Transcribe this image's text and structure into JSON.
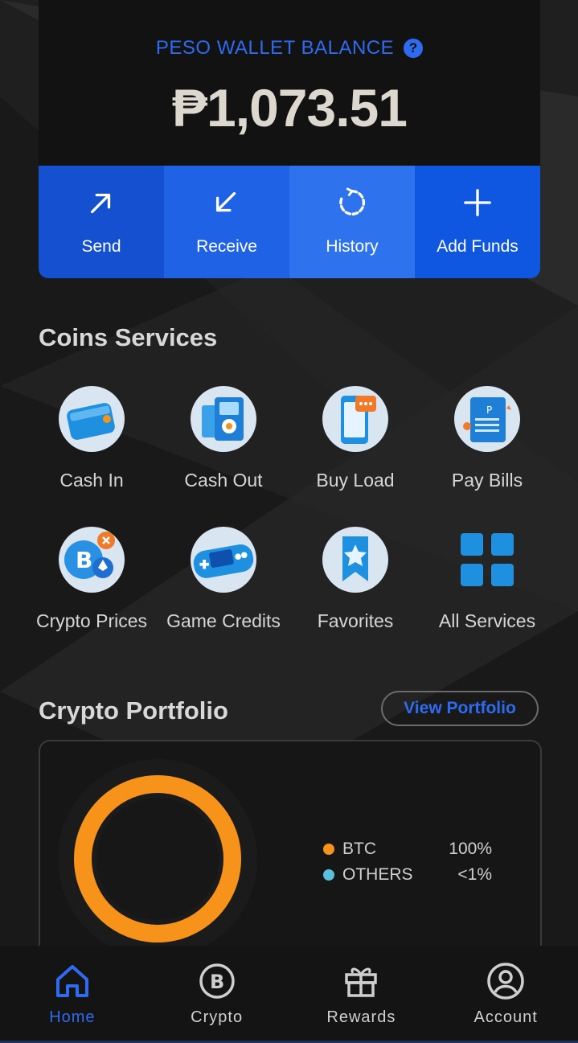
{
  "balance": {
    "title": "PESO WALLET BALANCE",
    "amount": "₱1,073.51"
  },
  "actions": [
    {
      "label": "Send",
      "icon": "arrow-up-right-icon"
    },
    {
      "label": "Receive",
      "icon": "arrow-down-left-icon"
    },
    {
      "label": "History",
      "icon": "history-icon"
    },
    {
      "label": "Add Funds",
      "icon": "plus-icon"
    }
  ],
  "services": {
    "title": "Coins Services",
    "items": [
      {
        "label": "Cash In",
        "icon": "wallet-icon"
      },
      {
        "label": "Cash Out",
        "icon": "cash-out-icon"
      },
      {
        "label": "Buy Load",
        "icon": "phone-icon"
      },
      {
        "label": "Pay Bills",
        "icon": "bill-icon"
      },
      {
        "label": "Crypto Prices",
        "icon": "crypto-coins-icon"
      },
      {
        "label": "Game Credits",
        "icon": "gamepad-icon"
      },
      {
        "label": "Favorites",
        "icon": "star-bookmark-icon"
      },
      {
        "label": "All Services",
        "icon": "grid-icon"
      }
    ]
  },
  "portfolio": {
    "title": "Crypto Portfolio",
    "view_label": "View Portfolio",
    "legend": [
      {
        "name": "BTC",
        "value": "100%",
        "color": "#f7931a"
      },
      {
        "name": "OTHERS",
        "value": "<1%",
        "color": "#5bc0de"
      }
    ]
  },
  "chart_data": {
    "type": "pie",
    "categories": [
      "BTC",
      "OTHERS"
    ],
    "values": [
      100,
      0
    ],
    "colors": [
      "#f7931a",
      "#5bc0de"
    ]
  },
  "nav": {
    "items": [
      {
        "label": "Home",
        "icon": "home-icon",
        "active": true
      },
      {
        "label": "Crypto",
        "icon": "crypto-icon",
        "active": false
      },
      {
        "label": "Rewards",
        "icon": "gift-icon",
        "active": false
      },
      {
        "label": "Account",
        "icon": "account-icon",
        "active": false
      }
    ]
  },
  "colors": {
    "accent": "#2f6bf0",
    "btc": "#f7931a",
    "background": "#1f1f1f"
  }
}
